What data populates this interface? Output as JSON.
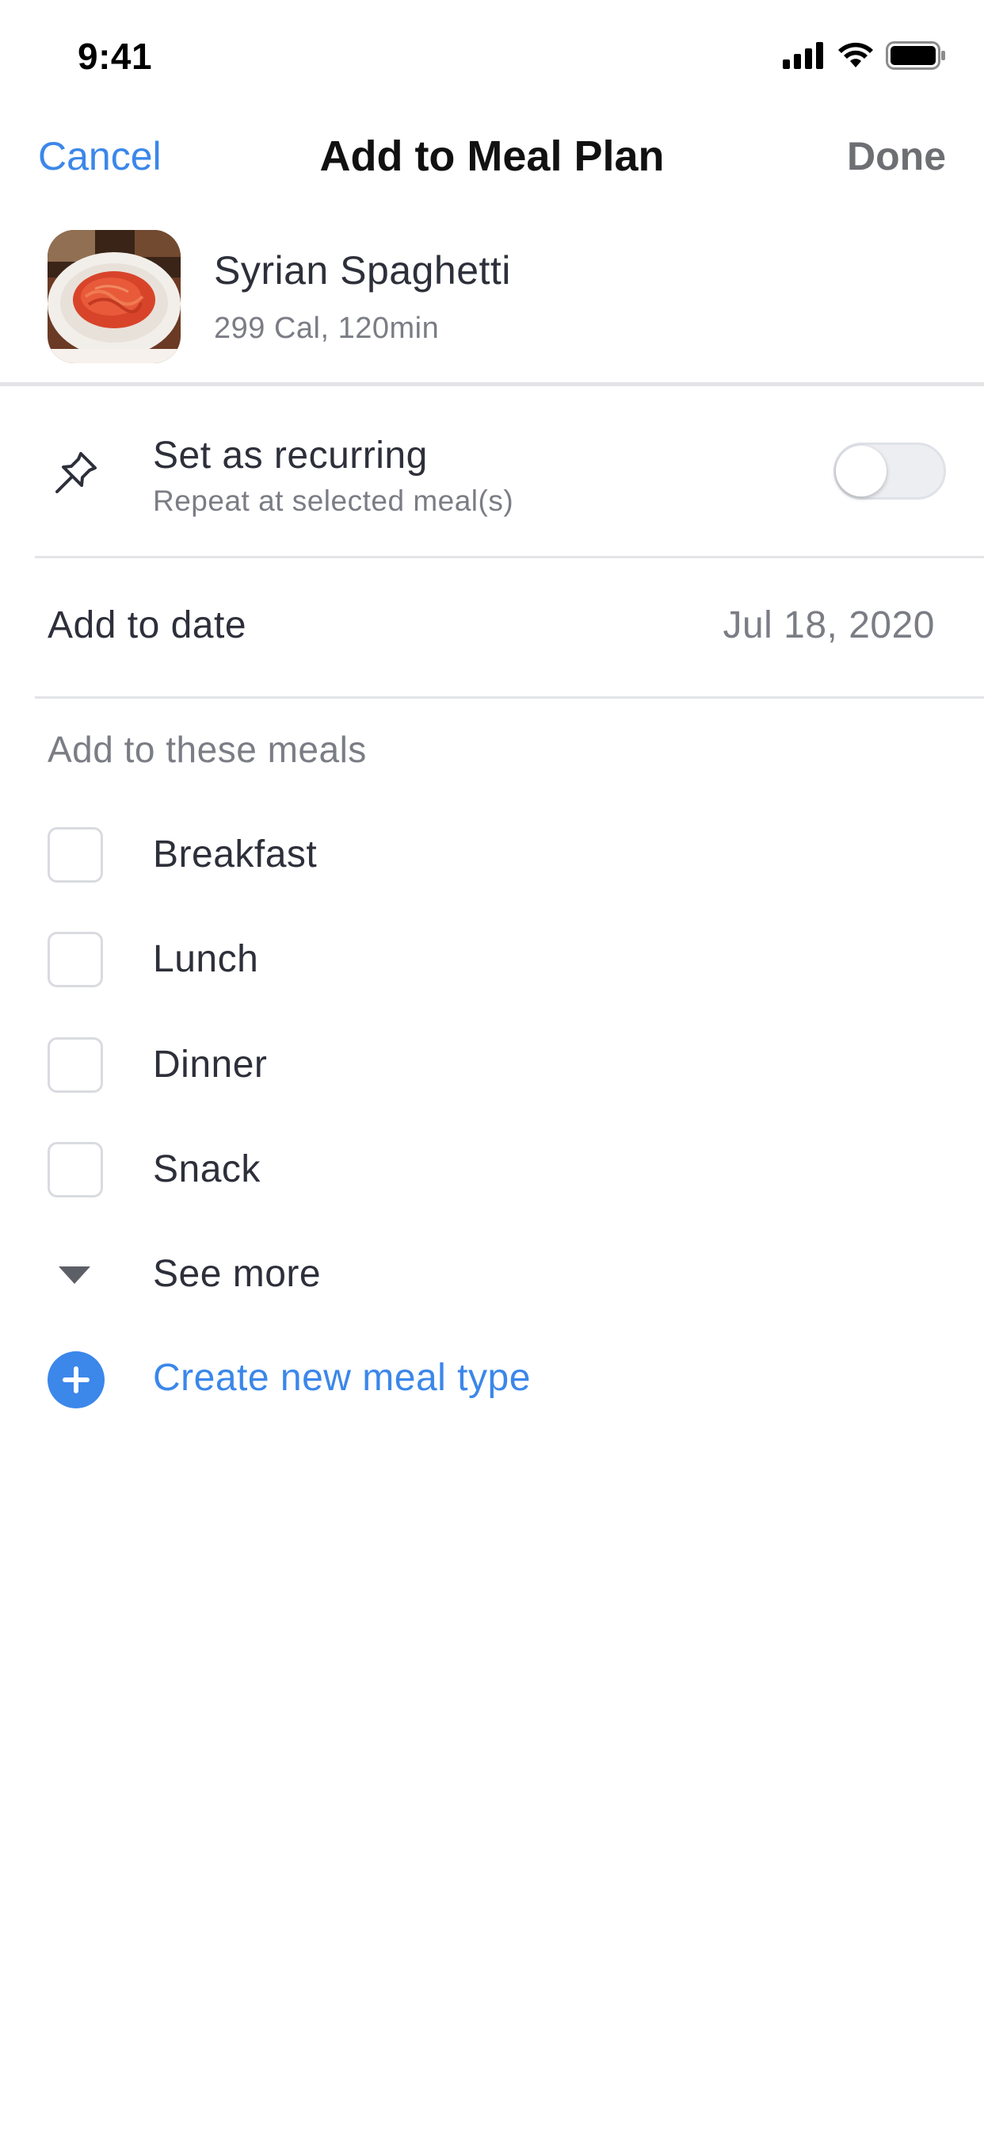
{
  "status_bar": {
    "time": "9:41",
    "icons": [
      "cellular-signal-icon",
      "wifi-icon",
      "battery-icon"
    ]
  },
  "nav": {
    "cancel_label": "Cancel",
    "title": "Add to Meal Plan",
    "done_label": "Done"
  },
  "recipe": {
    "name": "Syrian Spaghetti",
    "meta": "299 Cal, 120min"
  },
  "recurring": {
    "icon": "pin-icon",
    "title": "Set as recurring",
    "subtitle": "Repeat at selected meal(s)",
    "enabled": false
  },
  "date_row": {
    "label": "Add to date",
    "value": "Jul 18, 2020"
  },
  "meals": {
    "heading": "Add to these meals",
    "items": [
      {
        "label": "Breakfast",
        "checked": false
      },
      {
        "label": "Lunch",
        "checked": false
      },
      {
        "label": "Dinner",
        "checked": false
      },
      {
        "label": "Snack",
        "checked": false
      }
    ],
    "see_more_label": "See more",
    "create_label": "Create new meal type"
  },
  "colors": {
    "accent": "#3b87ea",
    "text_primary": "#2d2f3a",
    "text_secondary": "#7b7d85",
    "divider": "#e3e4e8"
  }
}
